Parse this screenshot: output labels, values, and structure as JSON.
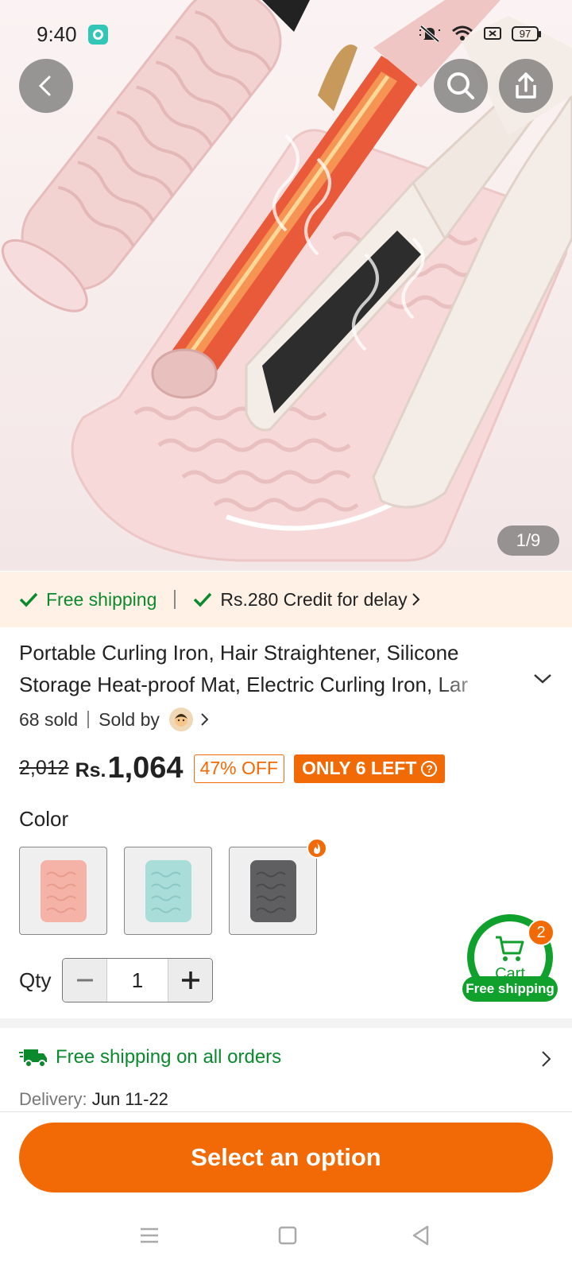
{
  "status_bar": {
    "time": "9:40",
    "battery": "97"
  },
  "gallery": {
    "counter": "1/9"
  },
  "shipping_strip": {
    "free_shipping": "Free shipping",
    "credit": "Rs.280 Credit for delay"
  },
  "product": {
    "title_line1": "Portable Curling Iron, Hair Straightener, Silicone",
    "title_line2": "Storage Heat-proof Mat, Electric Curling Iron, Lar",
    "sold": "68 sold",
    "sold_by": "Sold by"
  },
  "price": {
    "original": "2,012",
    "currency": "Rs.",
    "current": "1,064",
    "discount": "47% OFF",
    "stock": "ONLY 6 LEFT"
  },
  "color": {
    "label": "Color",
    "options": [
      {
        "swatch": "#f4b3a6"
      },
      {
        "swatch": "#a9ddd9"
      },
      {
        "swatch": "#5f5f62"
      }
    ]
  },
  "quantity": {
    "label": "Qty",
    "value": "1"
  },
  "cart": {
    "label": "Cart",
    "count": "2",
    "tag": "Free shipping"
  },
  "delivery": {
    "headline": "Free shipping on all orders",
    "label": "Delivery:",
    "date": "Jun 11-22"
  },
  "cta": {
    "label": "Select an option"
  },
  "colors": {
    "accent": "#f26a05",
    "green": "#10a02c",
    "strip_bg": "#fff1e6"
  }
}
